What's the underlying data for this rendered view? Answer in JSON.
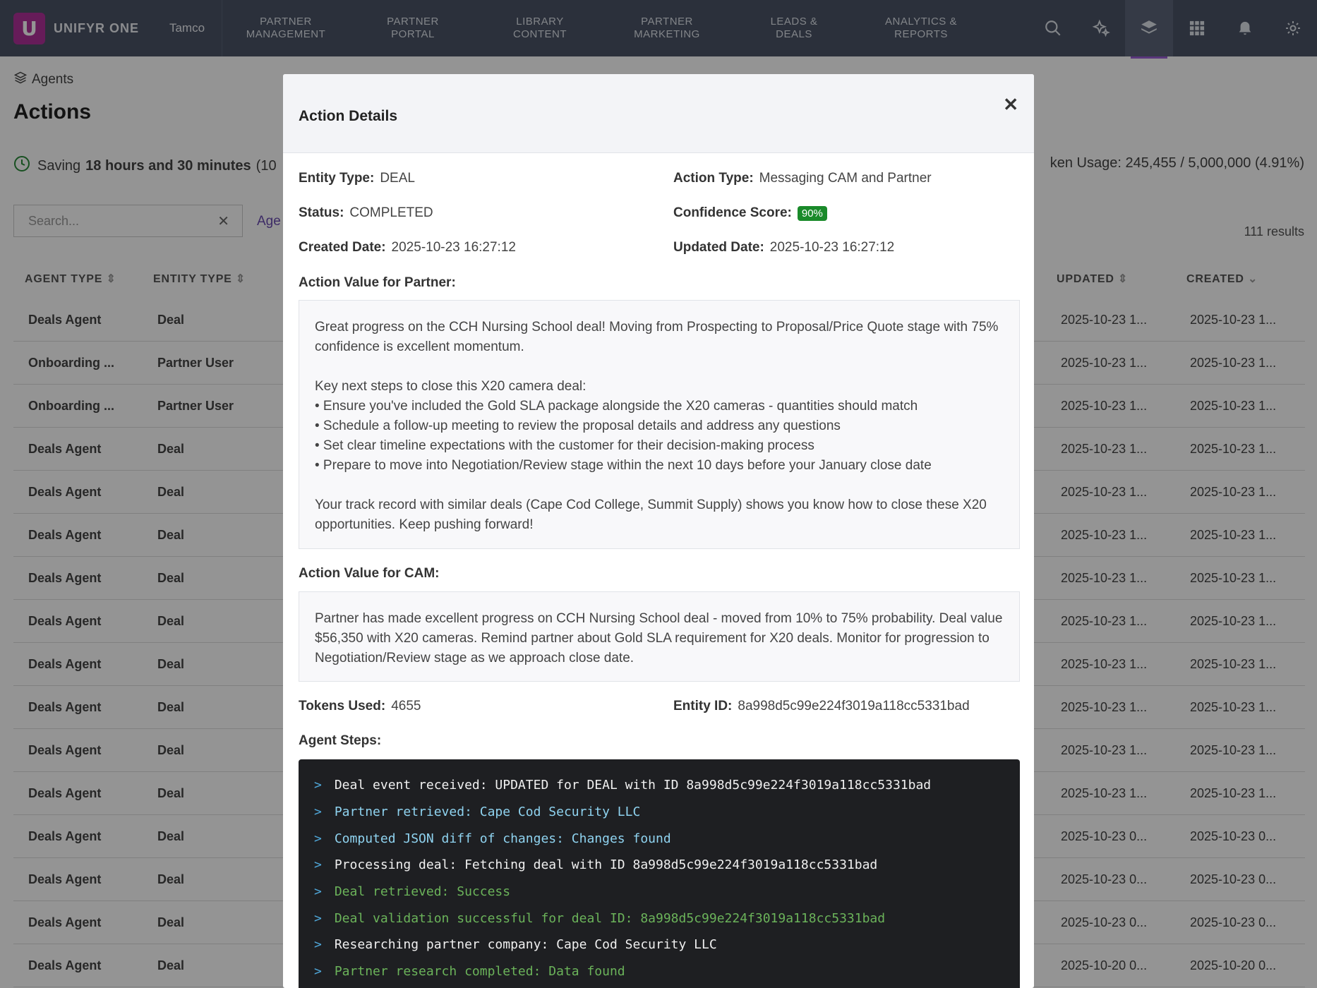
{
  "nav": {
    "logo_letter": "U",
    "brand": "UNIFYR ONE",
    "company": "Tamco",
    "items": [
      {
        "line1": "PARTNER",
        "line2": "MANAGEMENT"
      },
      {
        "line1": "PARTNER",
        "line2": "PORTAL"
      },
      {
        "line1": "LIBRARY",
        "line2": "CONTENT"
      },
      {
        "line1": "PARTNER",
        "line2": "MARKETING"
      },
      {
        "line1": "LEADS &",
        "line2": "DEALS"
      },
      {
        "line1": "ANALYTICS &",
        "line2": "REPORTS"
      }
    ],
    "icons": [
      "search-icon",
      "sparkle-icon",
      "layers-icon",
      "apps-grid-icon",
      "bell-icon",
      "gear-icon"
    ]
  },
  "page": {
    "breadcrumb": "Agents",
    "title": "Actions",
    "saving_prefix": "Saving",
    "saving_value": "18 hours and 30 minutes",
    "saving_suffix": "(10",
    "token_usage": "ken Usage: 245,455 / 5,000,000 (4.91%)",
    "search_placeholder": "Search...",
    "filter_link": "Age",
    "results": "111 results"
  },
  "table": {
    "headers": {
      "agent_type": "AGENT TYPE",
      "entity_type": "ENTITY TYPE",
      "updated": "UPDATED",
      "created": "CREATED"
    },
    "rows": [
      {
        "agent": "Deals Agent",
        "entity": "Deal",
        "updated": "2025-10-23 1...",
        "created": "2025-10-23 1..."
      },
      {
        "agent": "Onboarding ...",
        "entity": "Partner User",
        "updated": "2025-10-23 1...",
        "created": "2025-10-23 1..."
      },
      {
        "agent": "Onboarding ...",
        "entity": "Partner User",
        "updated": "2025-10-23 1...",
        "created": "2025-10-23 1..."
      },
      {
        "agent": "Deals Agent",
        "entity": "Deal",
        "updated": "2025-10-23 1...",
        "created": "2025-10-23 1..."
      },
      {
        "agent": "Deals Agent",
        "entity": "Deal",
        "updated": "2025-10-23 1...",
        "created": "2025-10-23 1..."
      },
      {
        "agent": "Deals Agent",
        "entity": "Deal",
        "updated": "2025-10-23 1...",
        "created": "2025-10-23 1..."
      },
      {
        "agent": "Deals Agent",
        "entity": "Deal",
        "updated": "2025-10-23 1...",
        "created": "2025-10-23 1..."
      },
      {
        "agent": "Deals Agent",
        "entity": "Deal",
        "updated": "2025-10-23 1...",
        "created": "2025-10-23 1..."
      },
      {
        "agent": "Deals Agent",
        "entity": "Deal",
        "updated": "2025-10-23 1...",
        "created": "2025-10-23 1..."
      },
      {
        "agent": "Deals Agent",
        "entity": "Deal",
        "updated": "2025-10-23 1...",
        "created": "2025-10-23 1..."
      },
      {
        "agent": "Deals Agent",
        "entity": "Deal",
        "updated": "2025-10-23 1...",
        "created": "2025-10-23 1..."
      },
      {
        "agent": "Deals Agent",
        "entity": "Deal",
        "updated": "2025-10-23 1...",
        "created": "2025-10-23 1..."
      },
      {
        "agent": "Deals Agent",
        "entity": "Deal",
        "updated": "2025-10-23 0...",
        "created": "2025-10-23 0..."
      },
      {
        "agent": "Deals Agent",
        "entity": "Deal",
        "updated": "2025-10-23 0...",
        "created": "2025-10-23 0..."
      },
      {
        "agent": "Deals Agent",
        "entity": "Deal",
        "updated": "2025-10-23 0...",
        "created": "2025-10-23 0..."
      },
      {
        "agent": "Deals Agent",
        "entity": "Deal",
        "updated": "2025-10-20 0...",
        "created": "2025-10-20 0..."
      }
    ]
  },
  "modal": {
    "title": "Action Details",
    "close": "✕",
    "entity_type_label": "Entity Type:",
    "entity_type": "DEAL",
    "action_type_label": "Action Type:",
    "action_type": "Messaging CAM and Partner",
    "status_label": "Status:",
    "status": "COMPLETED",
    "confidence_label": "Confidence Score:",
    "confidence": "90%",
    "created_label": "Created Date:",
    "created": "2025-10-23 16:27:12",
    "updated_label": "Updated Date:",
    "updated": "2025-10-23 16:27:12",
    "partner_value_label": "Action Value for Partner:",
    "partner_value": "Great progress on the CCH Nursing School deal! Moving from Prospecting to Proposal/Price Quote stage with 75% confidence is excellent momentum.\n\nKey next steps to close this X20 camera deal:\n• Ensure you've included the Gold SLA package alongside the X20 cameras - quantities should match\n• Schedule a follow-up meeting to review the proposal details and address any questions\n• Set clear timeline expectations with the customer for their decision-making process\n• Prepare to move into Negotiation/Review stage within the next 10 days before your January close date\n\nYour track record with similar deals (Cape Cod College, Summit Supply) shows you know how to close these X20 opportunities. Keep pushing forward!",
    "cam_value_label": "Action Value for CAM:",
    "cam_value": "Partner has made excellent progress on CCH Nursing School deal - moved from 10% to 75% probability. Deal value $56,350 with X20 cameras. Remind partner about Gold SLA requirement for X20 deals. Monitor for progression to Negotiation/Review stage as we approach close date.",
    "tokens_label": "Tokens Used:",
    "tokens": "4655",
    "entity_id_label": "Entity ID:",
    "entity_id": "8a998d5c99e224f3019a118cc5331bad",
    "steps_label": "Agent Steps:",
    "prompt": ">",
    "steps": [
      {
        "text": "Deal event received: UPDATED for DEAL with ID 8a998d5c99e224f3019a118cc5331bad",
        "tone": "w"
      },
      {
        "text": "Partner retrieved: Cape Cod Security LLC",
        "tone": "c"
      },
      {
        "text": "Computed JSON diff of changes: Changes found",
        "tone": "c"
      },
      {
        "text": "Processing deal: Fetching deal with ID 8a998d5c99e224f3019a118cc5331bad",
        "tone": "w"
      },
      {
        "text": "Deal retrieved: Success",
        "tone": "g"
      },
      {
        "text": "Deal validation successful for deal ID: 8a998d5c99e224f3019a118cc5331bad",
        "tone": "g"
      },
      {
        "text": "Researching partner company: Cape Cod Security LLC",
        "tone": "w"
      },
      {
        "text": "Partner research completed: Data found",
        "tone": "g"
      }
    ]
  },
  "colors": {
    "nav_bg": "#4a5366",
    "brand_logo": "#b0319a",
    "accent": "#9b5fd6",
    "badge": "#1a8a2a",
    "terminal_bg": "#1e1f22"
  }
}
